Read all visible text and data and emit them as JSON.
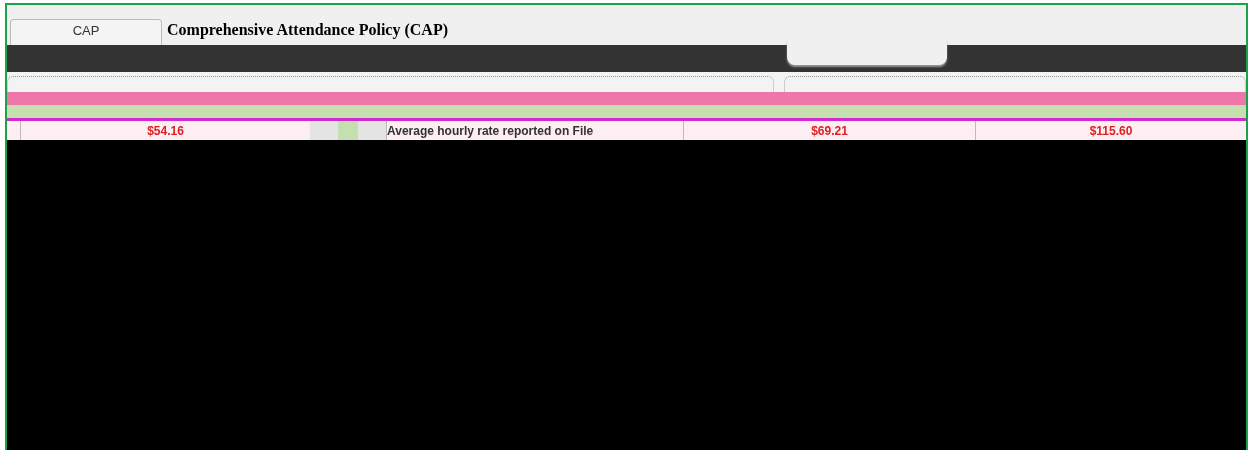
{
  "tab": {
    "label": "CAP",
    "selected": true
  },
  "title": "Comprehensive Attendance Policy (CAP)",
  "row": {
    "cells": [
      {
        "kind": "amount",
        "text": "$54.16"
      },
      {
        "kind": "label",
        "text": "Average hourly rate reported on File"
      },
      {
        "kind": "amount",
        "text": "$69.21"
      },
      {
        "kind": "amount",
        "text": "$115.60"
      }
    ]
  }
}
